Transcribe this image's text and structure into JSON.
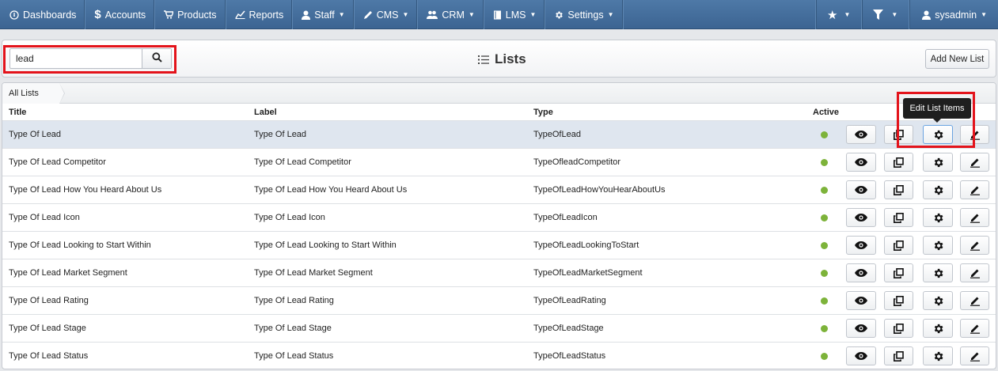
{
  "nav": {
    "items": [
      {
        "label": "Dashboards",
        "icon": "dashboard-icon",
        "caret": false
      },
      {
        "label": "Accounts",
        "icon": "dollar-icon",
        "caret": false
      },
      {
        "label": "Products",
        "icon": "cart-icon",
        "caret": false
      },
      {
        "label": "Reports",
        "icon": "chart-icon",
        "caret": false
      },
      {
        "label": "Staff",
        "icon": "user-icon",
        "caret": true
      },
      {
        "label": "CMS",
        "icon": "pencil-icon",
        "caret": true
      },
      {
        "label": "CRM",
        "icon": "users-icon",
        "caret": true
      },
      {
        "label": "LMS",
        "icon": "book-icon",
        "caret": true
      },
      {
        "label": "Settings",
        "icon": "gear-icon",
        "caret": true
      }
    ],
    "right": {
      "favorites_icon": "star-icon",
      "filter_icon": "filter-icon",
      "user_label": "sysadmin",
      "user_icon": "user-icon"
    }
  },
  "search": {
    "value": "lead",
    "placeholder": ""
  },
  "page_title": "Lists",
  "add_button_label": "Add New List",
  "breadcrumb": {
    "label": "All Lists"
  },
  "columns": {
    "title": "Title",
    "label": "Label",
    "type": "Type",
    "active": "Active"
  },
  "tooltip": "Edit List Items",
  "rows": [
    {
      "title": "Type Of Lead",
      "label": "Type Of Lead",
      "type": "TypeOfLead",
      "active": true
    },
    {
      "title": "Type Of Lead Competitor",
      "label": "Type Of Lead Competitor",
      "type": "TypeOfleadCompetitor",
      "active": true
    },
    {
      "title": "Type Of Lead How You Heard About Us",
      "label": "Type Of Lead How You Heard About Us",
      "type": "TypeOfLeadHowYouHearAboutUs",
      "active": true
    },
    {
      "title": "Type Of Lead Icon",
      "label": "Type Of Lead Icon",
      "type": "TypeOfLeadIcon",
      "active": true
    },
    {
      "title": "Type Of Lead Looking to Start Within",
      "label": "Type Of Lead Looking to Start Within",
      "type": "TypeOfLeadLookingToStart",
      "active": true
    },
    {
      "title": "Type Of Lead Market Segment",
      "label": "Type Of Lead Market Segment",
      "type": "TypeOfLeadMarketSegment",
      "active": true
    },
    {
      "title": "Type Of Lead Rating",
      "label": "Type Of Lead Rating",
      "type": "TypeOfLeadRating",
      "active": true
    },
    {
      "title": "Type Of Lead Stage",
      "label": "Type Of Lead Stage",
      "type": "TypeOfLeadStage",
      "active": true
    },
    {
      "title": "Type Of Lead Status",
      "label": "Type Of Lead Status",
      "type": "TypeOfLeadStatus",
      "active": true
    }
  ],
  "colors": {
    "navbar": "#3c6492",
    "active_dot": "#7db33a",
    "highlight_box": "#e3131b",
    "selected_row": "#dfe6ef"
  }
}
